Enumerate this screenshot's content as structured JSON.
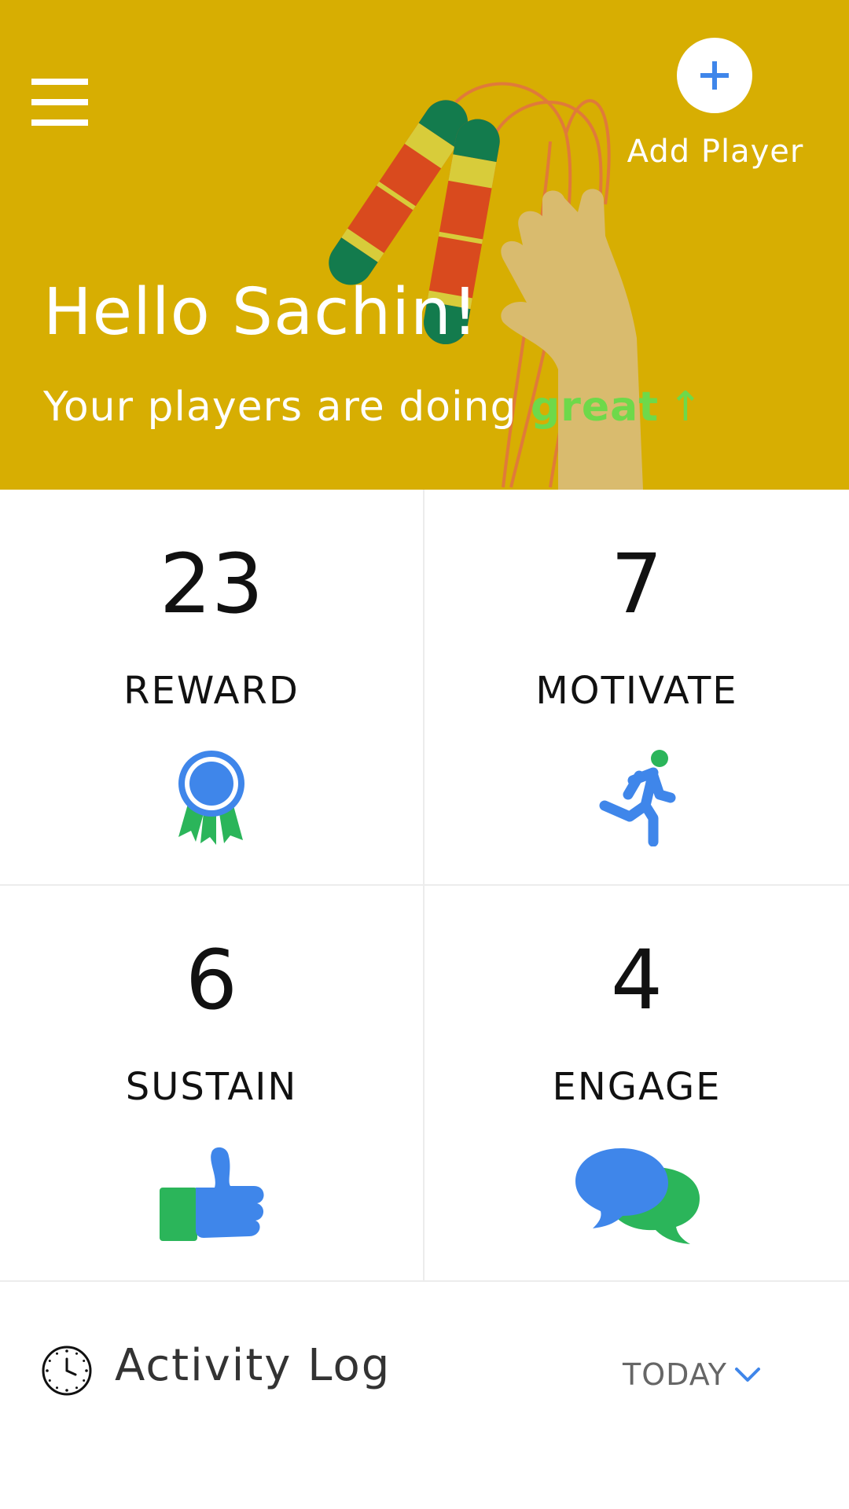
{
  "header": {
    "menu_icon": "hamburger-menu-icon",
    "add_player_icon": "plus-icon",
    "add_player_label": "Add Player",
    "greeting": "Hello Sachin!",
    "tagline_prefix": "Your players are doing ",
    "tagline_accent": "great",
    "tagline_arrow": "↑",
    "background_color": "#d7ae02",
    "accent_color": "#6ed94a"
  },
  "stats": [
    {
      "value": "23",
      "label": "REWARD",
      "icon": "award-ribbon-icon"
    },
    {
      "value": "7",
      "label": "MOTIVATE",
      "icon": "running-person-icon"
    },
    {
      "value": "6",
      "label": "SUSTAIN",
      "icon": "thumbs-up-icon"
    },
    {
      "value": "4",
      "label": "ENGAGE",
      "icon": "chat-bubbles-icon"
    }
  ],
  "activity": {
    "icon": "clock-icon",
    "title": "Activity Log",
    "filter_label": "TODAY",
    "filter_icon": "chevron-down-icon"
  },
  "colors": {
    "blue": "#3f86ea",
    "green": "#2bb55a"
  }
}
